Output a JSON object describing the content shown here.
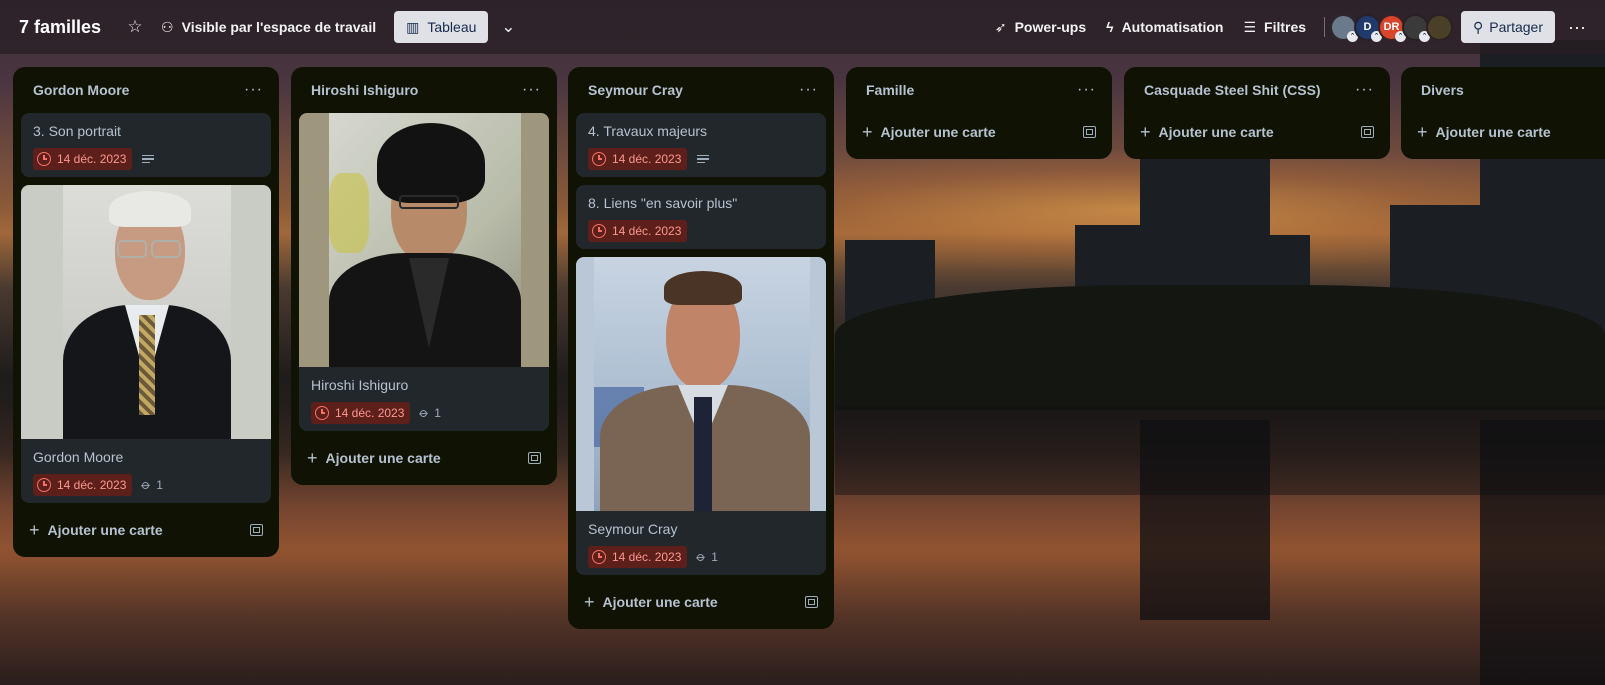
{
  "header": {
    "board_title": "7 familles",
    "visibility_label": "Visible par l'espace de travail",
    "view_label": "Tableau",
    "powerups_label": "Power-ups",
    "automation_label": "Automatisation",
    "filters_label": "Filtres",
    "avatars": [
      {
        "initials": "",
        "color": "#6a7a8a"
      },
      {
        "initials": "D",
        "color": "#1f3a6b"
      },
      {
        "initials": "DR",
        "color": "#d8452b"
      },
      {
        "initials": "",
        "color": "#3a3a3a"
      },
      {
        "initials": "",
        "color": "#4a4028"
      }
    ],
    "share_label": "Partager"
  },
  "lists": [
    {
      "title": "Gordon Moore",
      "cards": [
        {
          "title": "3. Son portrait",
          "date": "14 déc. 2023",
          "has_description": true
        },
        {
          "title": "Gordon Moore",
          "date": "14 déc. 2023",
          "attachments": "1",
          "cover": "portrait-gordon-moore"
        }
      ],
      "add_label": "Ajouter une carte"
    },
    {
      "title": "Hiroshi Ishiguro",
      "cards": [
        {
          "title": "Hiroshi Ishiguro",
          "date": "14 déc. 2023",
          "attachments": "1",
          "cover": "portrait-hiroshi-ishiguro"
        }
      ],
      "add_label": "Ajouter une carte"
    },
    {
      "title": "Seymour Cray",
      "cards": [
        {
          "title": "4. Travaux majeurs",
          "date": "14 déc. 2023",
          "has_description": true
        },
        {
          "title": "8. Liens \"en savoir plus\"",
          "date": "14 déc. 2023"
        },
        {
          "title": "Seymour Cray",
          "date": "14 déc. 2023",
          "attachments": "1",
          "cover": "portrait-seymour-cray"
        }
      ],
      "add_label": "Ajouter une carte"
    },
    {
      "title": "Famille",
      "cards": [],
      "add_label": "Ajouter une carte"
    },
    {
      "title": "Casquade Steel Shit (CSS)",
      "cards": [],
      "add_label": "Ajouter une carte"
    },
    {
      "title": "Divers",
      "cards": [],
      "add_label": "Ajouter une carte"
    }
  ],
  "colors": {
    "list_bg": "#101204",
    "card_bg": "#22272b",
    "date_badge_bg": "#5d1f1a",
    "date_badge_text": "#fd9891"
  }
}
